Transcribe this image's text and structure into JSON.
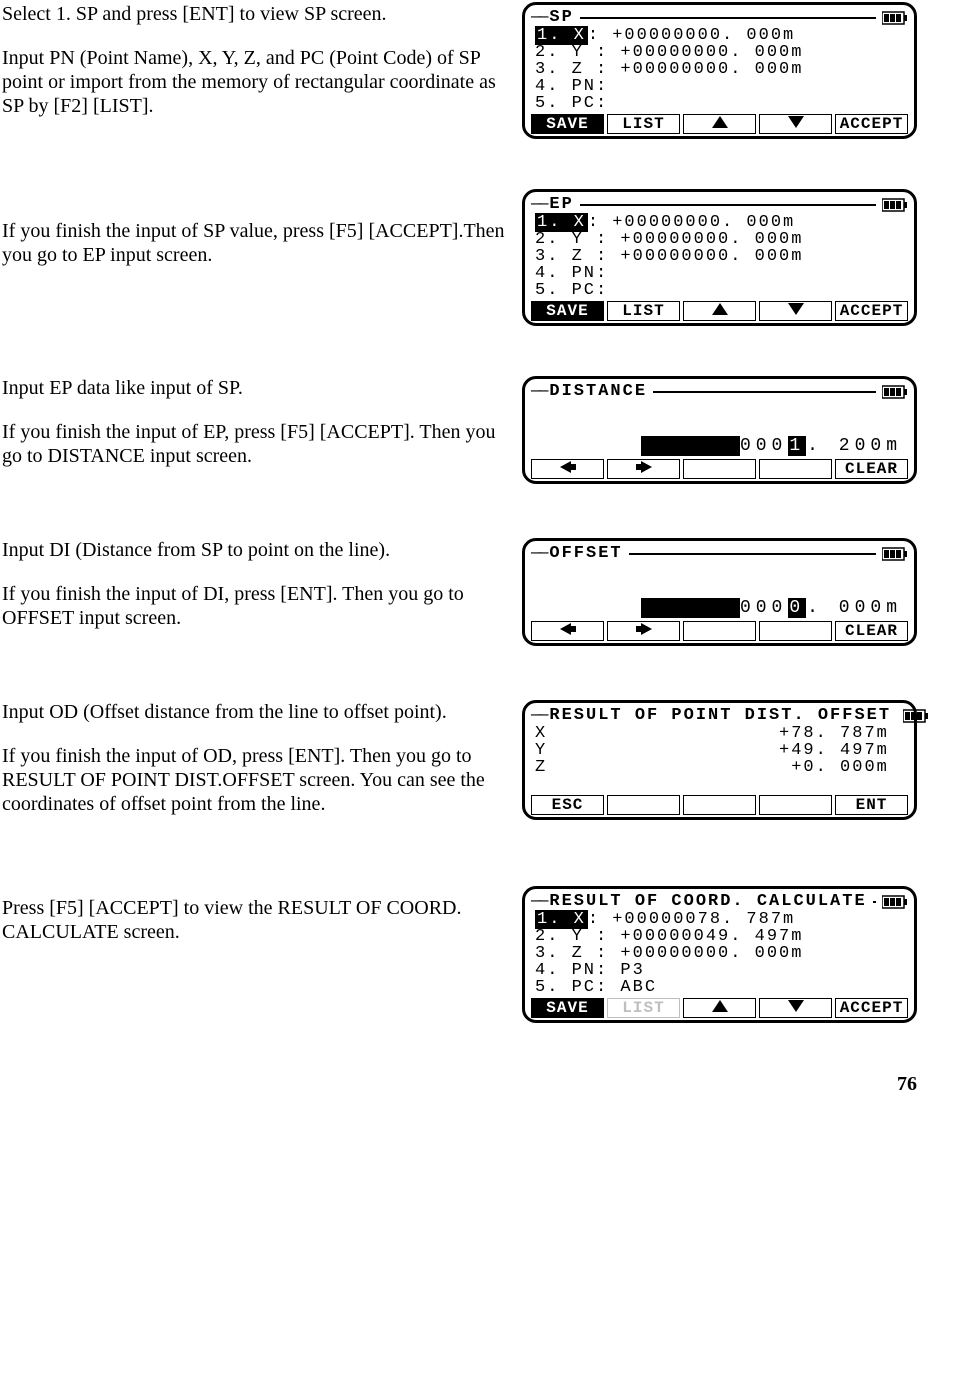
{
  "page_number": "76",
  "steps": [
    {
      "paragraphs": [
        "Select 1. SP and press [ENT] to view SP screen.",
        "Input PN (Point Name), X, Y, Z, and PC (Point Code) of SP point or import from the memory of rectangular coordinate as SP by [F2] [LIST]."
      ],
      "screen": {
        "title": "SP",
        "rows": [
          {
            "label": "1. X",
            "inv": true,
            "value": "+00000000. 000m"
          },
          {
            "label": "2. Y ",
            "inv": false,
            "value": "+00000000. 000m"
          },
          {
            "label": "3. Z ",
            "inv": false,
            "value": "+00000000. 000m"
          },
          {
            "label": "4. PN",
            "inv": false,
            "value": ""
          },
          {
            "label": "5. PC",
            "inv": false,
            "value": ""
          }
        ],
        "fkeys": [
          {
            "t": "SAVE",
            "inv": true
          },
          {
            "t": "LIST"
          },
          {
            "t": "↑",
            "arrow": "up"
          },
          {
            "t": "↓",
            "arrow": "down"
          },
          {
            "t": "ACCEPT"
          }
        ]
      }
    },
    {
      "paragraphs": [
        "If you finish the input of SP value, press [F5] [ACCEPT].Then you go to EP input screen."
      ],
      "screen": {
        "title": "EP",
        "rows": [
          {
            "label": "1. X",
            "inv": true,
            "value": "+00000000. 000m"
          },
          {
            "label": "2. Y ",
            "inv": false,
            "value": "+00000000. 000m"
          },
          {
            "label": "3. Z ",
            "inv": false,
            "value": "+00000000. 000m"
          },
          {
            "label": "4. PN",
            "inv": false,
            "value": ""
          },
          {
            "label": "5. PC",
            "inv": false,
            "value": ""
          }
        ],
        "fkeys": [
          {
            "t": "SAVE",
            "inv": true
          },
          {
            "t": "LIST"
          },
          {
            "t": "↑",
            "arrow": "up"
          },
          {
            "t": "↓",
            "arrow": "down"
          },
          {
            "t": "ACCEPT"
          }
        ]
      }
    },
    {
      "paragraphs": [
        "Input EP data like input of SP.",
        "If you finish the input of EP, press [F5] [ACCEPT]. Then you go to DISTANCE input screen."
      ],
      "screen": {
        "title": "DISTANCE",
        "input": {
          "lead": "0001",
          "hl": ".",
          "tail": " 200m"
        },
        "fkeys": [
          {
            "t": "←",
            "arrow": "left"
          },
          {
            "t": "→",
            "arrow": "right"
          },
          {
            "t": ""
          },
          {
            "t": ""
          },
          {
            "t": "CLEAR"
          }
        ]
      }
    },
    {
      "paragraphs": [
        "Input DI (Distance from SP to point on the line).",
        "If you finish the input of DI, press [ENT]. Then you go to OFFSET input screen."
      ],
      "screen": {
        "title": "OFFSET",
        "input": {
          "lead": "0000",
          "hl": ".",
          "tail": " 000m"
        },
        "fkeys": [
          {
            "t": "←",
            "arrow": "left"
          },
          {
            "t": "→",
            "arrow": "right"
          },
          {
            "t": ""
          },
          {
            "t": ""
          },
          {
            "t": "CLEAR"
          }
        ]
      }
    },
    {
      "paragraphs": [
        "Input OD (Offset distance from the line to offset point).",
        "If you finish the input of OD, press [ENT]. Then you go to RESULT OF POINT DIST.OFFSET screen. You can see the coordinates of offset point from the line."
      ],
      "screen": {
        "title": "RESULT OF POINT DIST. OFFSET",
        "result_rows": [
          {
            "label": "X",
            "value": "+78. 787m"
          },
          {
            "label": "Y",
            "value": "+49. 497m"
          },
          {
            "label": "Z",
            "value": " +0. 000m"
          }
        ],
        "fkeys": [
          {
            "t": "ESC"
          },
          {
            "t": ""
          },
          {
            "t": ""
          },
          {
            "t": ""
          },
          {
            "t": "ENT"
          }
        ]
      }
    },
    {
      "paragraphs": [
        "Press [F5] [ACCEPT] to view the  RESULT OF COORD. CALCULATE screen."
      ],
      "screen": {
        "title": "RESULT OF COORD. CALCULATE",
        "rows": [
          {
            "label": "1. X",
            "inv": true,
            "value": "+00000078. 787m"
          },
          {
            "label": "2. Y ",
            "inv": false,
            "value": "+00000049. 497m"
          },
          {
            "label": "3. Z ",
            "inv": false,
            "value": "+00000000. 000m"
          },
          {
            "label": "4. PN",
            "inv": false,
            "value": "P3"
          },
          {
            "label": "5. PC",
            "inv": false,
            "value": "ABC"
          }
        ],
        "fkeys": [
          {
            "t": "SAVE",
            "inv": true
          },
          {
            "t": "LIST",
            "disabled": true
          },
          {
            "t": "↑",
            "arrow": "up"
          },
          {
            "t": "↓",
            "arrow": "down"
          },
          {
            "t": "ACCEPT"
          }
        ]
      }
    }
  ]
}
